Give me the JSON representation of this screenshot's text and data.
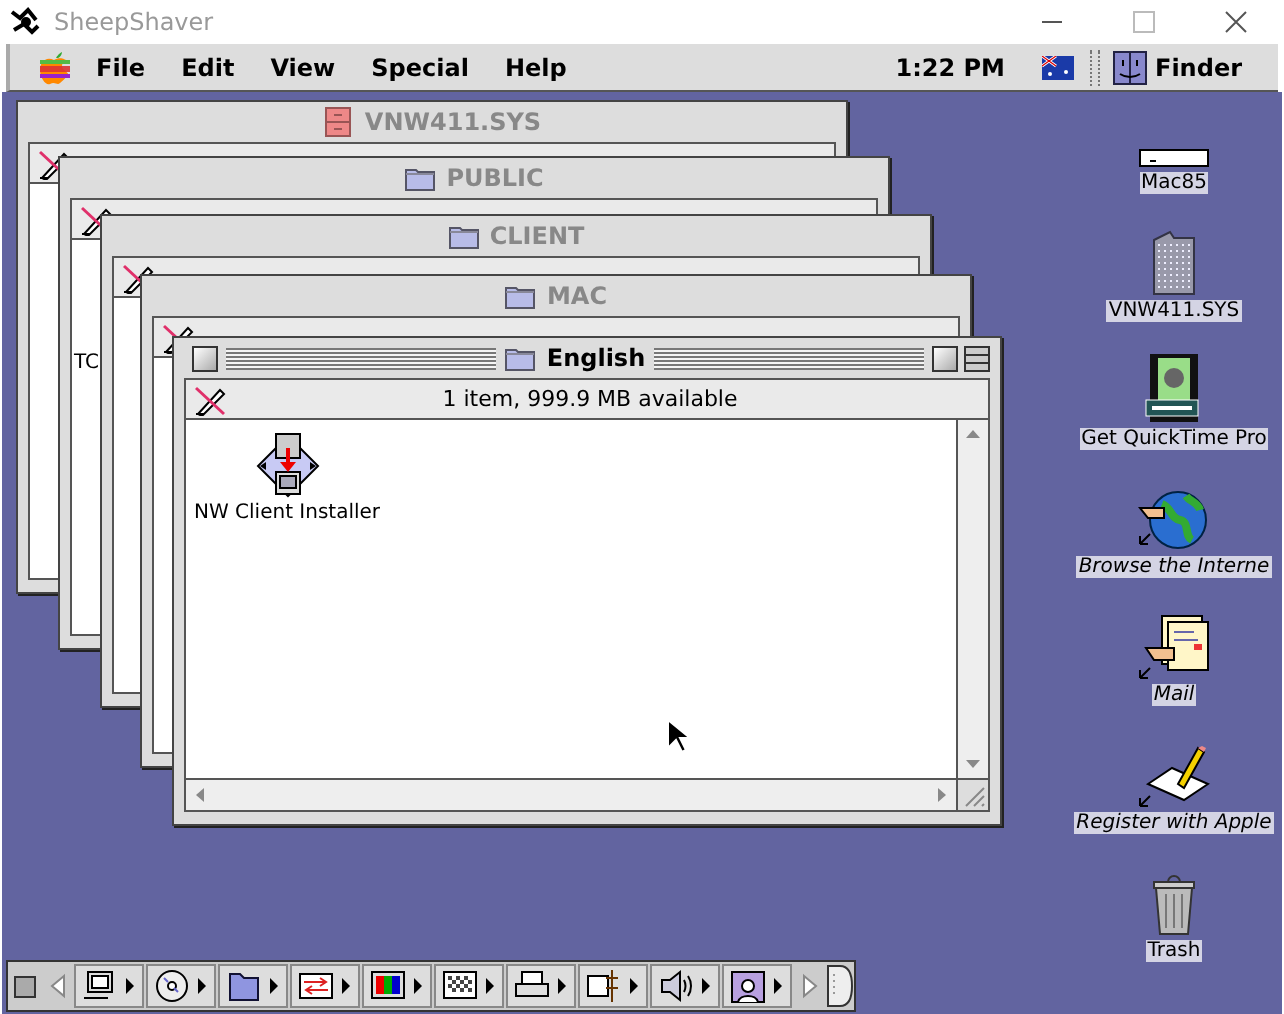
{
  "host_window": {
    "title": "SheepShaver"
  },
  "menu_bar": {
    "menus": [
      "File",
      "Edit",
      "View",
      "Special",
      "Help"
    ],
    "clock": "1:22 PM",
    "app": "Finder"
  },
  "windows": [
    {
      "title": "VNW411.SYS",
      "kind": "drawer",
      "active": false
    },
    {
      "title": "PUBLIC",
      "kind": "folder",
      "active": false,
      "items": [
        {
          "label": "TC"
        }
      ]
    },
    {
      "title": "CLIENT",
      "kind": "folder",
      "active": false
    },
    {
      "title": "MAC",
      "kind": "folder",
      "active": false
    },
    {
      "title": "English",
      "kind": "folder",
      "active": true,
      "info": "1 item, 999.9 MB available",
      "items": [
        {
          "label": "NW Client Installer",
          "kind": "installer"
        }
      ]
    }
  ],
  "desktop_icons": [
    {
      "label": "Mac85",
      "kind": "disk",
      "alias": false
    },
    {
      "label": "VNW411.SYS",
      "kind": "server",
      "alias": false
    },
    {
      "label": "Get QuickTime Pro",
      "kind": "movie",
      "alias": false
    },
    {
      "label": "Browse the Interne",
      "kind": "globe",
      "alias": true
    },
    {
      "label": "Mail",
      "kind": "mail",
      "alias": true
    },
    {
      "label": "Register with Apple",
      "kind": "register",
      "alias": true
    },
    {
      "label": "Trash",
      "kind": "trash",
      "alias": false
    }
  ],
  "control_strip": {
    "modules": [
      {
        "kind": "computer"
      },
      {
        "kind": "cd"
      },
      {
        "kind": "folder"
      },
      {
        "kind": "network"
      },
      {
        "kind": "monitor"
      },
      {
        "kind": "pattern"
      },
      {
        "kind": "printer"
      },
      {
        "kind": "remote"
      },
      {
        "kind": "sound"
      },
      {
        "kind": "user"
      }
    ]
  }
}
